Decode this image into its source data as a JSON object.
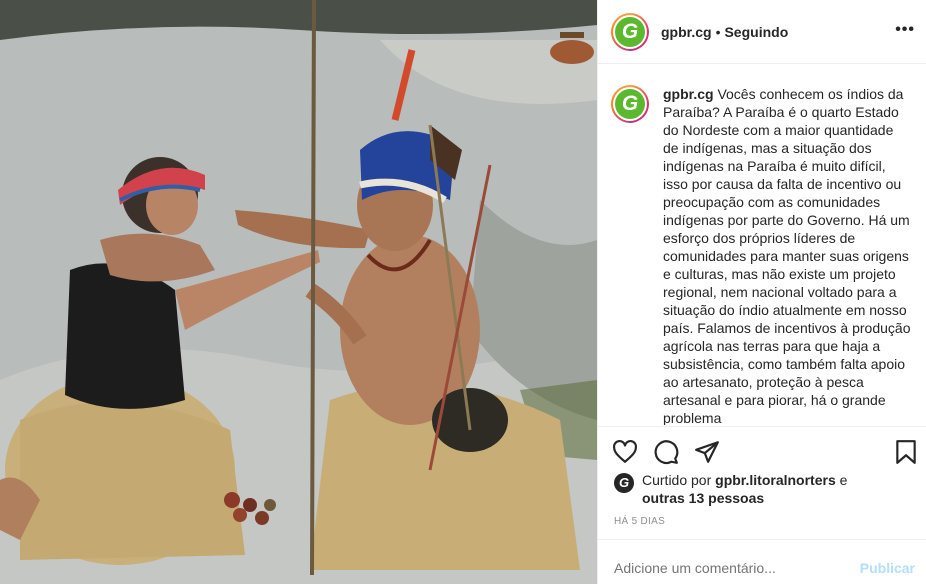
{
  "photo": {
    "alt": "",
    "sky_color": "#a0a6a4"
  },
  "header": {
    "avatar_letter": "G",
    "username": "gpbr.cg",
    "separator": "•",
    "follow_label": "Seguindo",
    "more_label": "•••"
  },
  "caption": {
    "username": "gpbr.cg",
    "text": "Vocês conhecem os índios da Paraíba? A Paraíba é o quarto Estado do Nordeste com a maior quantidade de indígenas, mas a situação dos indígenas na Paraíba é muito difícil, isso por causa da falta de incentivo ou preocupação com as comunidades indígenas por parte do Governo. Há um esforço dos próprios líderes de comunidades para manter suas origens e culturas, mas não existe um projeto regional, nem nacional voltado para a situação do índio atualmente em nosso país. Falamos de incentivos à produção agrícola nas terras para que haja a subsistência, como também falta apoio ao artesanato, proteção à pesca artesanal e para piorar, há o grande problema"
  },
  "actions": {
    "like_icon": "heart-icon",
    "comment_icon": "comment-icon",
    "share_icon": "share-icon",
    "save_icon": "bookmark-icon"
  },
  "likes": {
    "mini_avatar_letter": "G",
    "prefix": "Curtido por ",
    "liker": "gpbr.litoralnorters",
    "conjunction": " e",
    "others": "outras 13 pessoas"
  },
  "timestamp": "HÁ 5 DIAS",
  "comment_box": {
    "placeholder": "Adicione um comentário...",
    "post_label": "Publicar"
  },
  "colors": {
    "brand_green": "#5cb82f",
    "post_button_disabled": "#b2dffc",
    "muted_text": "#8e8e8e"
  }
}
